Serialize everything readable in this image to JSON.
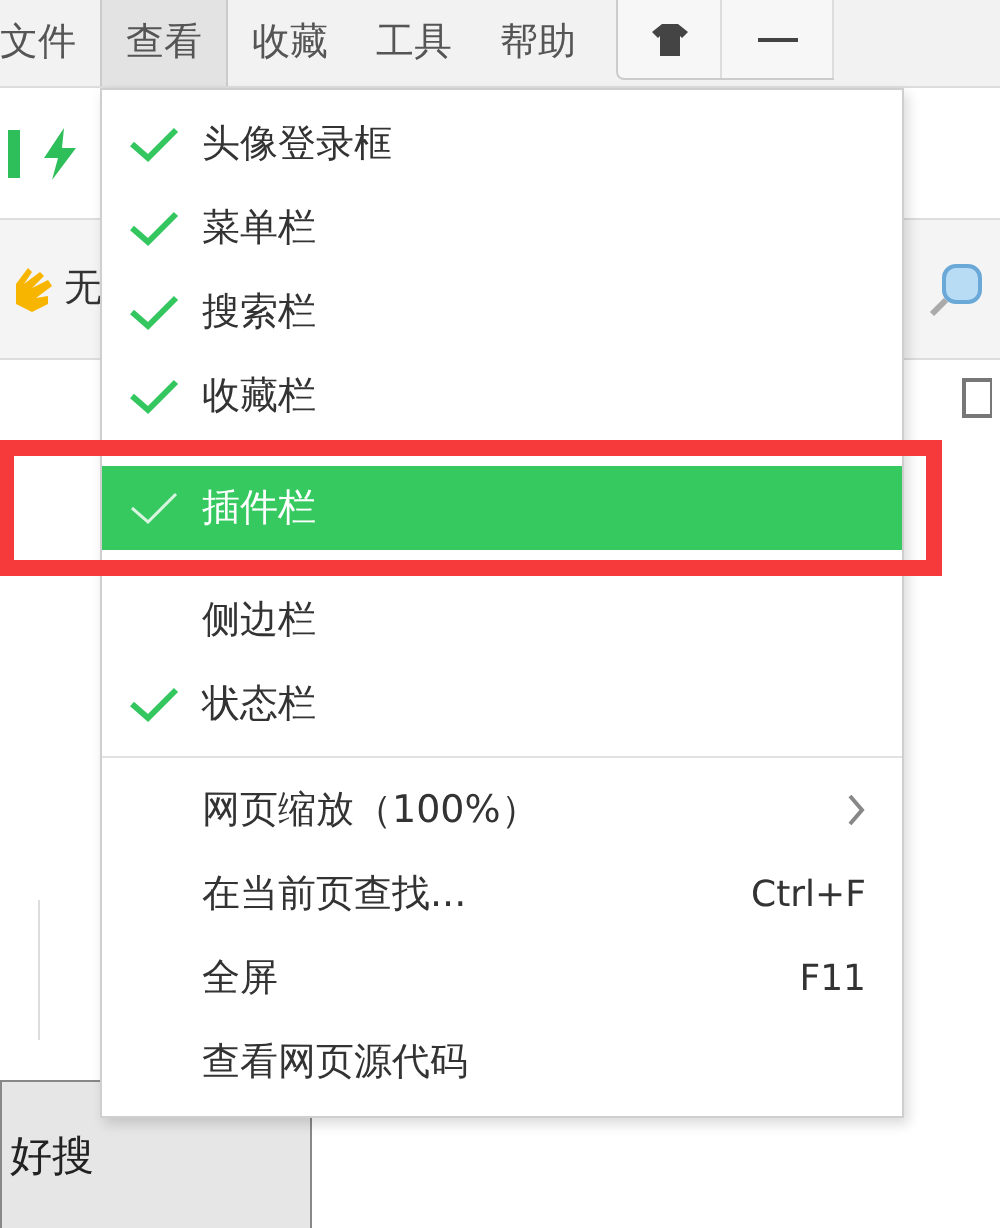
{
  "menu_bar": {
    "items": [
      {
        "label": "文件",
        "selected": false
      },
      {
        "label": "查看",
        "selected": true
      },
      {
        "label": "收藏",
        "selected": false
      },
      {
        "label": "工具",
        "selected": false
      },
      {
        "label": "帮助",
        "selected": false
      }
    ]
  },
  "toolbar": {
    "label": "无",
    "search_button": "好搜"
  },
  "view_menu": {
    "items": [
      {
        "kind": "toggle",
        "label": "头像登录框",
        "checked": true,
        "selected": false
      },
      {
        "kind": "toggle",
        "label": "菜单栏",
        "checked": true,
        "selected": false
      },
      {
        "kind": "toggle",
        "label": "搜索栏",
        "checked": true,
        "selected": false
      },
      {
        "kind": "toggle",
        "label": "收藏栏",
        "checked": true,
        "selected": false
      },
      {
        "kind": "toggle",
        "label": "插件栏",
        "checked": true,
        "selected": true
      },
      {
        "kind": "toggle",
        "label": "侧边栏",
        "checked": false,
        "selected": false
      },
      {
        "kind": "toggle",
        "label": "状态栏",
        "checked": true,
        "selected": false
      },
      {
        "kind": "separator"
      },
      {
        "kind": "submenu",
        "label": "网页缩放（100%）",
        "selected": false
      },
      {
        "kind": "command",
        "label": "在当前页查找...",
        "shortcut": "Ctrl+F",
        "selected": false
      },
      {
        "kind": "command",
        "label": "全屏",
        "shortcut": "F11",
        "selected": false
      },
      {
        "kind": "command",
        "label": "查看网页源代码",
        "selected": false
      }
    ]
  }
}
